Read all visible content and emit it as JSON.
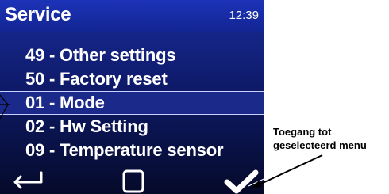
{
  "header": {
    "title": "Service",
    "time": "12:39"
  },
  "menu": {
    "items": [
      {
        "label": "49 - Other settings"
      },
      {
        "label": "50 - Factory reset"
      },
      {
        "label": "01 - Mode"
      },
      {
        "label": "02 - Hw Setting"
      },
      {
        "label": "09 - Temperature sensor"
      }
    ],
    "selected_label": "01 - Mode"
  },
  "footer": {
    "back_icon": "back-arrow-icon",
    "home_icon": "square-icon",
    "confirm_icon": "check-icon"
  },
  "annotation": {
    "line1": "Toegang tot",
    "line2": "geselecteerd menu"
  },
  "colors": {
    "screen_top": "#1a2c9a",
    "screen_bottom": "#050a2a",
    "text": "#ffffff",
    "annotation_text": "#000000"
  }
}
